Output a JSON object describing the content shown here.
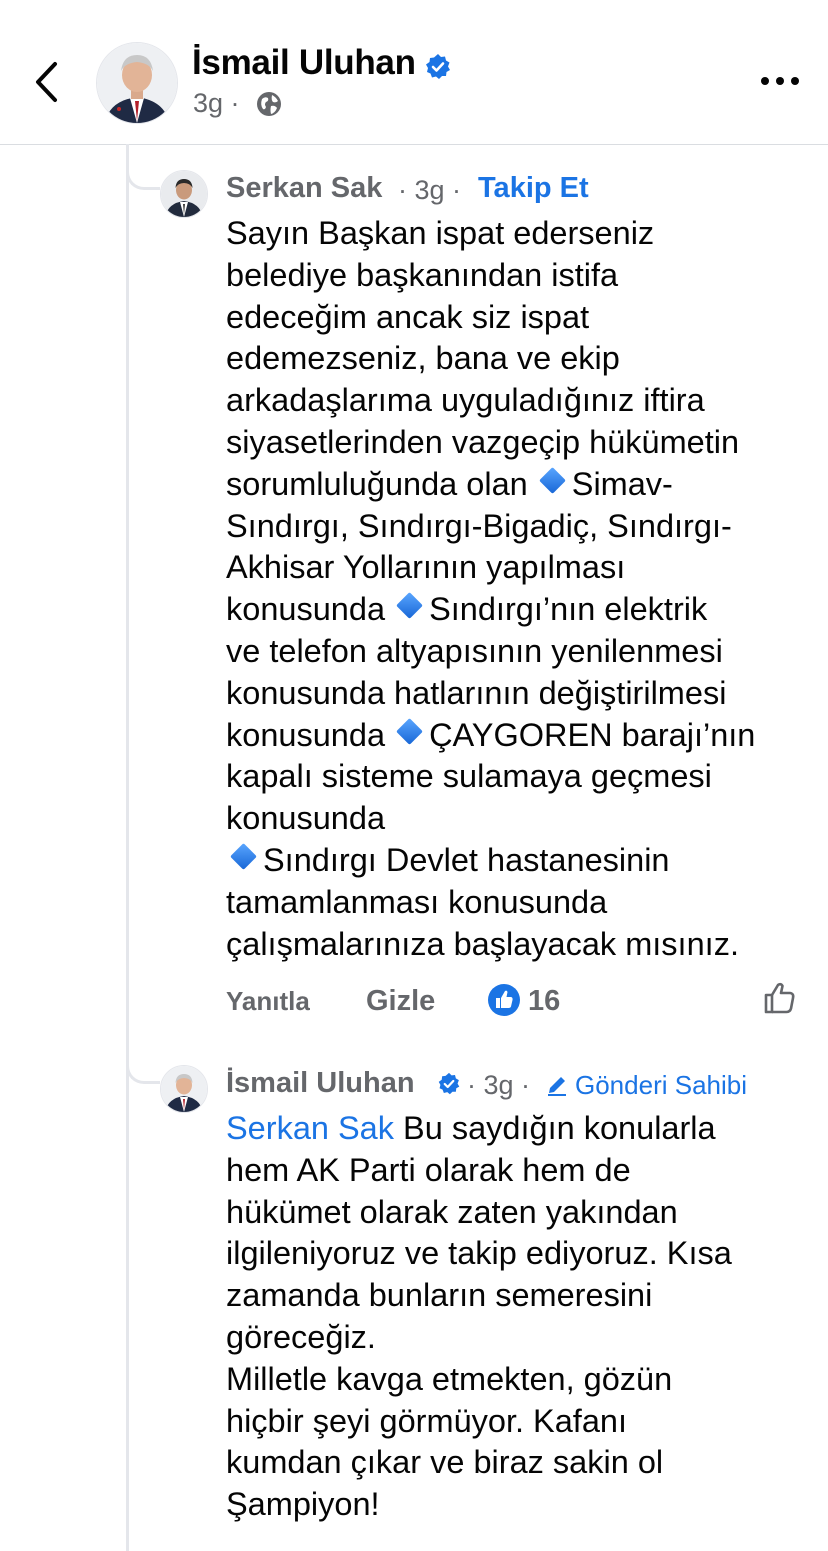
{
  "header": {
    "title": "İsmail Uluhan",
    "time": "3g ·",
    "back_icon": "chevron-left-icon",
    "more_icon": "more-horizontal-icon",
    "privacy_icon": "globe-icon"
  },
  "comments": [
    {
      "author": "Serkan Sak",
      "time": "· 3g ·",
      "follow_label": "Takip Et",
      "lines": [
        "Sayın Başkan ispat ederseniz",
        "belediye başkanından istifa",
        "edeceğim ancak siz ispat",
        "edemezseniz,  bana ve ekip",
        "arkadaşlarıma uyguladığınız iftira",
        "siyasetlerinden vazgeçip hükümetin",
        "sorumluluğunda olan ",
        "Simav-",
        "Sındırgı, Sındırgı-Bigadiç, Sındırgı-",
        "Akhisar Yollarının yapılması",
        "konusunda ",
        "Sındırgı’nın elektrik",
        "ve telefon altyapısının yenilenmesi",
        "konusunda hatlarının değiştirilmesi",
        "konusunda ",
        "ÇAYGOREN barajı’nın",
        "kapalı sisteme sulamaya geçmesi",
        "konusunda",
        "Sındırgı Devlet hastanesinin",
        "tamamlanması konusunda",
        "çalışmalarınıza başlayacak mısınız."
      ],
      "reply_label": "Yanıtla",
      "hide_label": "Gizle",
      "reaction_count": "16"
    },
    {
      "author": "İsmail Uluhan",
      "time": "· 3g ·",
      "badge_label": "Gönderi Sahibi",
      "mention": "Serkan Sak",
      "lines": [
        " Bu saydığın konularla",
        "hem AK Parti olarak hem de",
        "hükümet olarak zaten yakından",
        "ilgileniyoruz ve takip ediyoruz. Kısa",
        "zamanda bunların semeresini",
        "göreceğiz.",
        "Milletle kavga etmekten, gözün",
        "hiçbir şeyi görmüyor. Kafanı",
        "kumdan çıkar ve biraz sakin ol",
        "Şampiyon!"
      ]
    }
  ],
  "colors": {
    "accent": "#1b74e4",
    "secondary_text": "#65676b",
    "divider": "#e4e6eb"
  }
}
